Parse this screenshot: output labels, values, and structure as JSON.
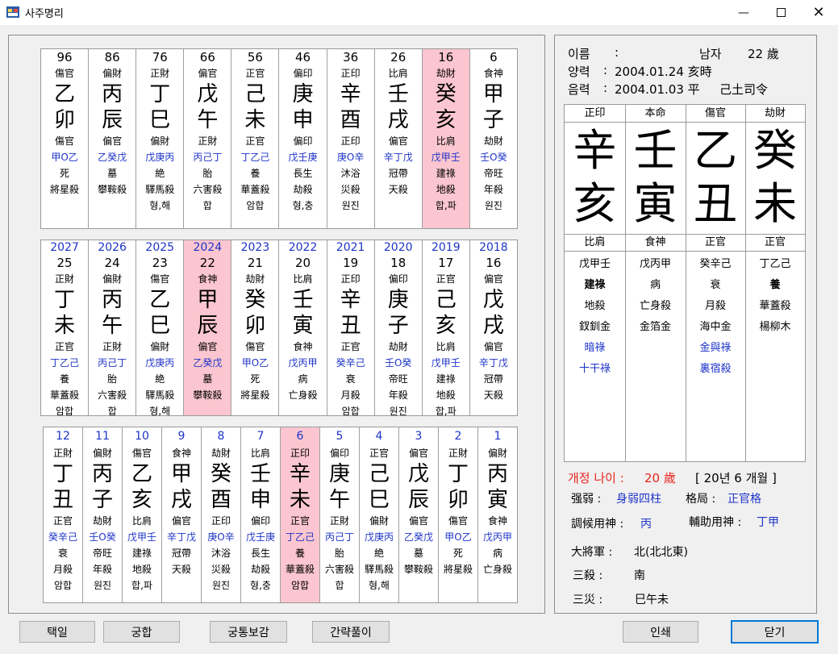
{
  "window": {
    "title": "사주명리"
  },
  "daeun": [
    {
      "age": "96",
      "top": "傷官",
      "g1": "乙",
      "g2": "卯",
      "s1": "傷官",
      "hidden": "甲O乙",
      "st": "死",
      "sal": "將星殺",
      "ex": "",
      "hl": false
    },
    {
      "age": "86",
      "top": "偏財",
      "g1": "丙",
      "g2": "辰",
      "s1": "偏官",
      "hidden": "乙癸戊",
      "st": "墓",
      "sal": "攀鞍殺",
      "ex": "",
      "hl": false
    },
    {
      "age": "76",
      "top": "正財",
      "g1": "丁",
      "g2": "巳",
      "s1": "偏財",
      "hidden": "戊庚丙",
      "st": "絶",
      "sal": "驛馬殺",
      "ex": "형,해",
      "hl": false
    },
    {
      "age": "66",
      "top": "偏官",
      "g1": "戊",
      "g2": "午",
      "s1": "正財",
      "hidden": "丙己丁",
      "st": "胎",
      "sal": "六害殺",
      "ex": "합",
      "hl": false
    },
    {
      "age": "56",
      "top": "正官",
      "g1": "己",
      "g2": "未",
      "s1": "正官",
      "hidden": "丁乙己",
      "st": "養",
      "sal": "華蓋殺",
      "ex": "암합",
      "hl": false
    },
    {
      "age": "46",
      "top": "偏印",
      "g1": "庚",
      "g2": "申",
      "s1": "偏印",
      "hidden": "戊壬庚",
      "st": "長生",
      "sal": "劫殺",
      "ex": "형,충",
      "hl": false
    },
    {
      "age": "36",
      "top": "正印",
      "g1": "辛",
      "g2": "酉",
      "s1": "正印",
      "hidden": "庚O辛",
      "st": "沐浴",
      "sal": "災殺",
      "ex": "원진",
      "hl": false
    },
    {
      "age": "26",
      "top": "比肩",
      "g1": "壬",
      "g2": "戌",
      "s1": "偏官",
      "hidden": "辛丁戊",
      "st": "冠帶",
      "sal": "天殺",
      "ex": "",
      "hl": false
    },
    {
      "age": "16",
      "top": "劫財",
      "g1": "癸",
      "g2": "亥",
      "s1": "比肩",
      "hidden": "戊甲壬",
      "st": "建祿",
      "sal": "地殺",
      "ex": "합,파",
      "hl": true
    },
    {
      "age": "6",
      "top": "食神",
      "g1": "甲",
      "g2": "子",
      "s1": "劫財",
      "hidden": "壬O癸",
      "st": "帝旺",
      "sal": "年殺",
      "ex": "원진",
      "hl": false
    }
  ],
  "seun": [
    {
      "year": "2027",
      "age": "25",
      "top": "正財",
      "g1": "丁",
      "g2": "未",
      "s1": "正官",
      "hidden": "丁乙己",
      "st": "養",
      "sal": "華蓋殺",
      "ex": "암합",
      "hl": false
    },
    {
      "year": "2026",
      "age": "24",
      "top": "偏財",
      "g1": "丙",
      "g2": "午",
      "s1": "正財",
      "hidden": "丙己丁",
      "st": "胎",
      "sal": "六害殺",
      "ex": "합",
      "hl": false
    },
    {
      "year": "2025",
      "age": "23",
      "top": "傷官",
      "g1": "乙",
      "g2": "巳",
      "s1": "偏財",
      "hidden": "戊庚丙",
      "st": "絶",
      "sal": "驛馬殺",
      "ex": "형,해",
      "hl": false
    },
    {
      "year": "2024",
      "age": "22",
      "top": "食神",
      "g1": "甲",
      "g2": "辰",
      "s1": "偏官",
      "hidden": "乙癸戊",
      "st": "墓",
      "sal": "攀鞍殺",
      "ex": "",
      "hl": true
    },
    {
      "year": "2023",
      "age": "21",
      "top": "劫財",
      "g1": "癸",
      "g2": "卯",
      "s1": "傷官",
      "hidden": "甲O乙",
      "st": "死",
      "sal": "將星殺",
      "ex": "",
      "hl": false
    },
    {
      "year": "2022",
      "age": "20",
      "top": "比肩",
      "g1": "壬",
      "g2": "寅",
      "s1": "食神",
      "hidden": "戊丙甲",
      "st": "病",
      "sal": "亡身殺",
      "ex": "",
      "hl": false
    },
    {
      "year": "2021",
      "age": "19",
      "top": "正印",
      "g1": "辛",
      "g2": "丑",
      "s1": "正官",
      "hidden": "癸辛己",
      "st": "衰",
      "sal": "月殺",
      "ex": "암합",
      "hl": false
    },
    {
      "year": "2020",
      "age": "18",
      "top": "偏印",
      "g1": "庚",
      "g2": "子",
      "s1": "劫財",
      "hidden": "壬O癸",
      "st": "帝旺",
      "sal": "年殺",
      "ex": "원진",
      "hl": false
    },
    {
      "year": "2019",
      "age": "17",
      "top": "正官",
      "g1": "己",
      "g2": "亥",
      "s1": "比肩",
      "hidden": "戊甲壬",
      "st": "建祿",
      "sal": "地殺",
      "ex": "합,파",
      "hl": false
    },
    {
      "year": "2018",
      "age": "16",
      "top": "偏官",
      "g1": "戊",
      "g2": "戌",
      "s1": "偏官",
      "hidden": "辛丁戊",
      "st": "冠帶",
      "sal": "天殺",
      "ex": "",
      "hl": false
    }
  ],
  "wolun": [
    {
      "month": "12",
      "top": "正財",
      "g1": "丁",
      "g2": "丑",
      "s1": "正官",
      "hidden": "癸辛己",
      "st": "衰",
      "sal": "月殺",
      "ex": "암합",
      "hl": false
    },
    {
      "month": "11",
      "top": "偏財",
      "g1": "丙",
      "g2": "子",
      "s1": "劫財",
      "hidden": "壬O癸",
      "st": "帝旺",
      "sal": "年殺",
      "ex": "원진",
      "hl": false
    },
    {
      "month": "10",
      "top": "傷官",
      "g1": "乙",
      "g2": "亥",
      "s1": "比肩",
      "hidden": "戊甲壬",
      "st": "建祿",
      "sal": "地殺",
      "ex": "합,파",
      "hl": false
    },
    {
      "month": "9",
      "top": "食神",
      "g1": "甲",
      "g2": "戌",
      "s1": "偏官",
      "hidden": "辛丁戊",
      "st": "冠帶",
      "sal": "天殺",
      "ex": "",
      "hl": false
    },
    {
      "month": "8",
      "top": "劫財",
      "g1": "癸",
      "g2": "酉",
      "s1": "正印",
      "hidden": "庚O辛",
      "st": "沐浴",
      "sal": "災殺",
      "ex": "원진",
      "hl": false
    },
    {
      "month": "7",
      "top": "比肩",
      "g1": "壬",
      "g2": "申",
      "s1": "偏印",
      "hidden": "戊壬庚",
      "st": "長生",
      "sal": "劫殺",
      "ex": "형,충",
      "hl": false
    },
    {
      "month": "6",
      "top": "正印",
      "g1": "辛",
      "g2": "未",
      "s1": "正官",
      "hidden": "丁乙己",
      "st": "養",
      "sal": "華蓋殺",
      "ex": "암합",
      "hl": true
    },
    {
      "month": "5",
      "top": "偏印",
      "g1": "庚",
      "g2": "午",
      "s1": "正財",
      "hidden": "丙己丁",
      "st": "胎",
      "sal": "六害殺",
      "ex": "합",
      "hl": false
    },
    {
      "month": "4",
      "top": "正官",
      "g1": "己",
      "g2": "巳",
      "s1": "偏財",
      "hidden": "戊庚丙",
      "st": "絶",
      "sal": "驛馬殺",
      "ex": "형,해",
      "hl": false
    },
    {
      "month": "3",
      "top": "偏官",
      "g1": "戊",
      "g2": "辰",
      "s1": "偏官",
      "hidden": "乙癸戊",
      "st": "墓",
      "sal": "攀鞍殺",
      "ex": "",
      "hl": false
    },
    {
      "month": "2",
      "top": "正財",
      "g1": "丁",
      "g2": "卯",
      "s1": "傷官",
      "hidden": "甲O乙",
      "st": "死",
      "sal": "將星殺",
      "ex": "",
      "hl": false
    },
    {
      "month": "1",
      "top": "偏財",
      "g1": "丙",
      "g2": "寅",
      "s1": "食神",
      "hidden": "戊丙甲",
      "st": "病",
      "sal": "亡身殺",
      "ex": "",
      "hl": false
    }
  ],
  "info": {
    "name_label": "이름",
    "name_value": "",
    "gender": "남자",
    "age": "22 歲",
    "solar_label": "양력",
    "solar_value": "2004.01.24 亥時",
    "lunar_label": "음력",
    "lunar_value": "2004.01.03 平",
    "saryeong": "己土司令"
  },
  "pillars": [
    {
      "head": "正印",
      "top": "辛",
      "bot": "亥",
      "sub": "比肩",
      "items": [
        "戊甲壬",
        "建祿",
        "地殺",
        "釵釧金",
        "暗祿",
        "十干祿"
      ],
      "item_styles": [
        "",
        "b",
        "",
        "",
        "blue",
        "blue"
      ]
    },
    {
      "head": "本命",
      "top": "壬",
      "bot": "寅",
      "sub": "食神",
      "items": [
        "戊丙甲",
        "病",
        "亡身殺",
        "金箔金"
      ],
      "item_styles": [
        "",
        "",
        "",
        ""
      ]
    },
    {
      "head": "傷官",
      "top": "乙",
      "bot": "丑",
      "sub": "正官",
      "items": [
        "癸辛己",
        "衰",
        "月殺",
        "海中金",
        "金與祿",
        "裏宿殺"
      ],
      "item_styles": [
        "",
        "",
        "",
        "",
        "blue",
        "blue"
      ]
    },
    {
      "head": "劫財",
      "top": "癸",
      "bot": "未",
      "sub": "正官",
      "items": [
        "丁乙己",
        "養",
        "華蓋殺",
        "楊柳木"
      ],
      "item_styles": [
        "",
        "b",
        "",
        ""
      ]
    }
  ],
  "summary": {
    "daeun_age_label": "개정 나이 :",
    "daeun_age_value": "20 歲",
    "daeun_period": "[ 20년 6 개월 ]",
    "strength_label": "强弱 :",
    "strength_value": "身弱四柱",
    "gyeok_label": "格局 :",
    "gyeok_value": "正官格",
    "johu_label": "調候用神 :",
    "johu_value": "丙",
    "bojo_label": "輔助用神 :",
    "bojo_value": "丁甲",
    "general_label": "大將軍 :",
    "general_value": "北(北北東)",
    "samsal_label": "三殺 :",
    "samsal_value": "南",
    "samjae_label": "三災 :",
    "samjae_value": "巳午未"
  },
  "buttons": {
    "b1": "택일",
    "b2": "궁합",
    "b3": "궁통보감",
    "b4": "간략풀이",
    "b5": "인쇄",
    "b6": "닫기"
  },
  "colors": {
    "highlight": "#fbc6cf",
    "blue": "#1e34c8",
    "red": "#e8251e"
  }
}
